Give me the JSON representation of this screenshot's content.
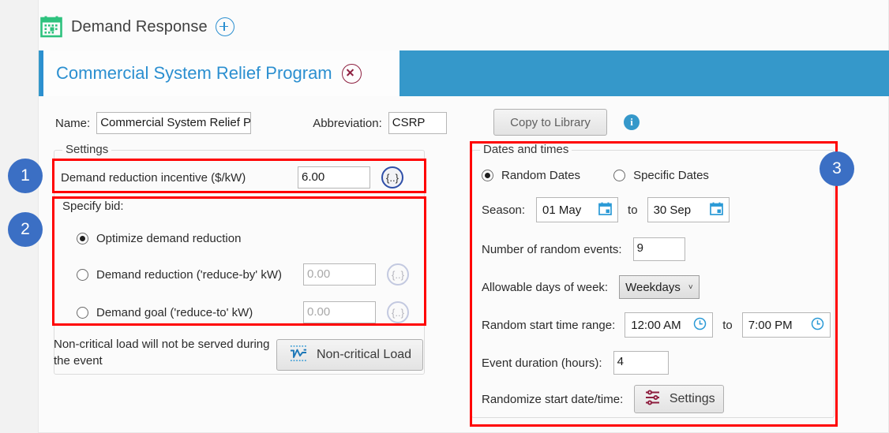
{
  "header": {
    "title": "Demand Response",
    "calendar_icon": "calendar-icon",
    "add_icon": "plus-icon"
  },
  "tab": {
    "label": "Commercial System Relief Program",
    "close_icon": "close-icon"
  },
  "form": {
    "name_label": "Name:",
    "name_value": "Commercial System Relief P",
    "abbreviation_label": "Abbreviation:",
    "abbreviation_value": "CSRP",
    "copy_to_library_label": "Copy to Library",
    "info_icon_glyph": "i"
  },
  "settings": {
    "group_title": "Settings",
    "incentive_label": "Demand reduction incentive ($/kW)",
    "incentive_value": "6.00",
    "expand_icon": "{..}",
    "bid_title": "Specify bid:",
    "bid_options": [
      {
        "label": "Optimize demand reduction",
        "selected": true,
        "value": null
      },
      {
        "label": "Demand reduction ('reduce-by' kW)",
        "selected": false,
        "value": "0.00"
      },
      {
        "label": "Demand goal ('reduce-to' kW)",
        "selected": false,
        "value": "0.00"
      }
    ]
  },
  "noncritical": {
    "description": "Non-critical load will not be served during the event",
    "button_label": "Non-critical Load",
    "button_icon": "waveform-icon"
  },
  "dates": {
    "group_title": "Dates and times",
    "mode_random_label": "Random Dates",
    "mode_specific_label": "Specific Dates",
    "mode_random_selected": true,
    "season_label": "Season:",
    "season_from": "01 May",
    "season_to": "30 Sep",
    "to_label": "to",
    "calendar_icon": "calendar-icon",
    "events_label": "Number of random events:",
    "events_value": "9",
    "days_label": "Allowable days of week:",
    "days_value": "Weekdays",
    "days_caret": "˅",
    "time_label": "Random start time range:",
    "time_from": "12:00 AM",
    "time_to": "7:00 PM",
    "clock_icon": "clock-icon",
    "duration_label": "Event duration (hours):",
    "duration_value": "4",
    "randomize_label": "Randomize start date/time:",
    "randomize_button_label": "Settings",
    "randomize_button_icon": "sliders-icon"
  },
  "annotations": {
    "badges": [
      "1",
      "2",
      "3"
    ],
    "box_color": "#ff0000",
    "badge_color": "#3b6fc4"
  }
}
